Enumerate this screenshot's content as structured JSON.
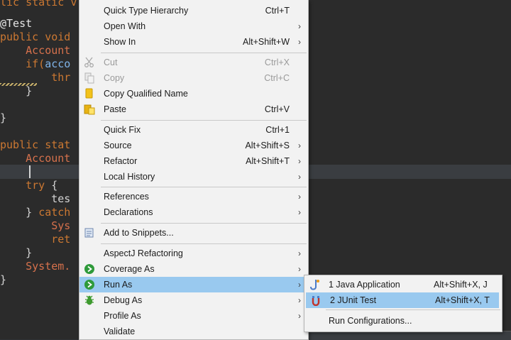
{
  "code": {
    "lines": [
      {
        "parts": [
          {
            "t": "lic static v",
            "c": "kw"
          }
        ]
      },
      {
        "parts": [
          {
            "t": "@Test",
            "c": "ann"
          }
        ]
      },
      {
        "parts": [
          {
            "t": "public void",
            "c": "kw"
          }
        ]
      },
      {
        "parts": [
          {
            "t": "    "
          },
          {
            "t": "Account",
            "c": "cls"
          }
        ]
      },
      {
        "parts": [
          {
            "t": "    "
          },
          {
            "t": "if(",
            "c": "kw"
          },
          {
            "t": "acco",
            "c": "cyan"
          }
        ]
      },
      {
        "parts": [
          {
            "t": "        "
          },
          {
            "t": "thr",
            "c": "kw"
          }
        ]
      },
      {
        "parts": [
          {
            "t": "    }",
            "c": "plain"
          }
        ]
      },
      {
        "parts": [
          {
            "t": "",
            "c": "plain"
          }
        ]
      },
      {
        "parts": [
          {
            "t": "}",
            "c": "plain"
          }
        ]
      },
      {
        "parts": [
          {
            "t": "",
            "c": "plain"
          }
        ]
      },
      {
        "parts": [
          {
            "t": "public stat",
            "c": "kw"
          }
        ]
      },
      {
        "parts": [
          {
            "t": "    "
          },
          {
            "t": "Account",
            "c": "cls"
          }
        ]
      },
      {
        "parts": [
          {
            "t": "",
            "c": "plain"
          }
        ]
      },
      {
        "parts": [
          {
            "t": "    "
          },
          {
            "t": "try",
            "c": "kw"
          },
          {
            "t": " {",
            "c": "plain"
          }
        ]
      },
      {
        "parts": [
          {
            "t": "        "
          },
          {
            "t": "tes",
            "c": "plain"
          }
        ]
      },
      {
        "parts": [
          {
            "t": "    } ",
            "c": "plain"
          },
          {
            "t": "catch",
            "c": "kw"
          }
        ]
      },
      {
        "parts": [
          {
            "t": "        "
          },
          {
            "t": "Sys",
            "c": "cls"
          }
        ]
      },
      {
        "parts": [
          {
            "t": "        "
          },
          {
            "t": "ret",
            "c": "kw"
          }
        ]
      },
      {
        "parts": [
          {
            "t": "    }",
            "c": "plain"
          }
        ]
      },
      {
        "parts": [
          {
            "t": "    "
          },
          {
            "t": "System.",
            "c": "cls"
          }
        ]
      },
      {
        "parts": [
          {
            "t": "}",
            "c": "plain"
          }
        ]
      }
    ]
  },
  "menu": {
    "items": [
      {
        "label": "Quick Type Hierarchy",
        "accel": "Ctrl+T",
        "submenu": false,
        "disabled": false,
        "icon": ""
      },
      {
        "label": "Open With",
        "accel": "",
        "submenu": true,
        "disabled": false,
        "icon": ""
      },
      {
        "label": "Show In",
        "accel": "Alt+Shift+W",
        "submenu": true,
        "disabled": false,
        "icon": ""
      },
      {
        "sep": true
      },
      {
        "label": "Cut",
        "accel": "Ctrl+X",
        "submenu": false,
        "disabled": true,
        "icon": "cut-icon"
      },
      {
        "label": "Copy",
        "accel": "Ctrl+C",
        "submenu": false,
        "disabled": true,
        "icon": "copy-icon"
      },
      {
        "label": "Copy Qualified Name",
        "accel": "",
        "submenu": false,
        "disabled": false,
        "icon": "copy-qualified-name-icon"
      },
      {
        "label": "Paste",
        "accel": "Ctrl+V",
        "submenu": false,
        "disabled": false,
        "icon": "paste-icon"
      },
      {
        "sep": true
      },
      {
        "label": "Quick Fix",
        "accel": "Ctrl+1",
        "submenu": false,
        "disabled": false,
        "icon": ""
      },
      {
        "label": "Source",
        "accel": "Alt+Shift+S",
        "submenu": true,
        "disabled": false,
        "icon": ""
      },
      {
        "label": "Refactor",
        "accel": "Alt+Shift+T",
        "submenu": true,
        "disabled": false,
        "icon": ""
      },
      {
        "label": "Local History",
        "accel": "",
        "submenu": true,
        "disabled": false,
        "icon": ""
      },
      {
        "sep": true
      },
      {
        "label": "References",
        "accel": "",
        "submenu": true,
        "disabled": false,
        "icon": ""
      },
      {
        "label": "Declarations",
        "accel": "",
        "submenu": true,
        "disabled": false,
        "icon": ""
      },
      {
        "sep": true
      },
      {
        "label": "Add to Snippets...",
        "accel": "",
        "submenu": false,
        "disabled": false,
        "icon": "snippets-icon"
      },
      {
        "sep": true
      },
      {
        "label": "AspectJ Refactoring",
        "accel": "",
        "submenu": true,
        "disabled": false,
        "icon": ""
      },
      {
        "label": "Coverage As",
        "accel": "",
        "submenu": true,
        "disabled": false,
        "icon": "coverage-icon"
      },
      {
        "label": "Run As",
        "accel": "",
        "submenu": true,
        "disabled": false,
        "selected": true,
        "icon": "run-icon"
      },
      {
        "label": "Debug As",
        "accel": "",
        "submenu": true,
        "disabled": false,
        "icon": "debug-bug-icon"
      },
      {
        "label": "Profile As",
        "accel": "",
        "submenu": true,
        "disabled": false,
        "icon": ""
      },
      {
        "label": "Validate",
        "accel": "",
        "submenu": false,
        "disabled": false,
        "icon": ""
      }
    ]
  },
  "run_as_submenu": {
    "items": [
      {
        "label": "1 Java Application",
        "accel": "Alt+Shift+X, J",
        "icon": "java-application-icon"
      },
      {
        "label": "2 JUnit Test",
        "accel": "Alt+Shift+X, T",
        "icon": "junit-icon",
        "selected": true
      },
      {
        "sep": true
      },
      {
        "label": "Run Configurations...",
        "accel": "",
        "icon": ""
      }
    ]
  },
  "colors": {
    "menu_bg": "#f2f2f2",
    "selection": "#99c9ef",
    "editor_bg": "#2b2b2b"
  }
}
